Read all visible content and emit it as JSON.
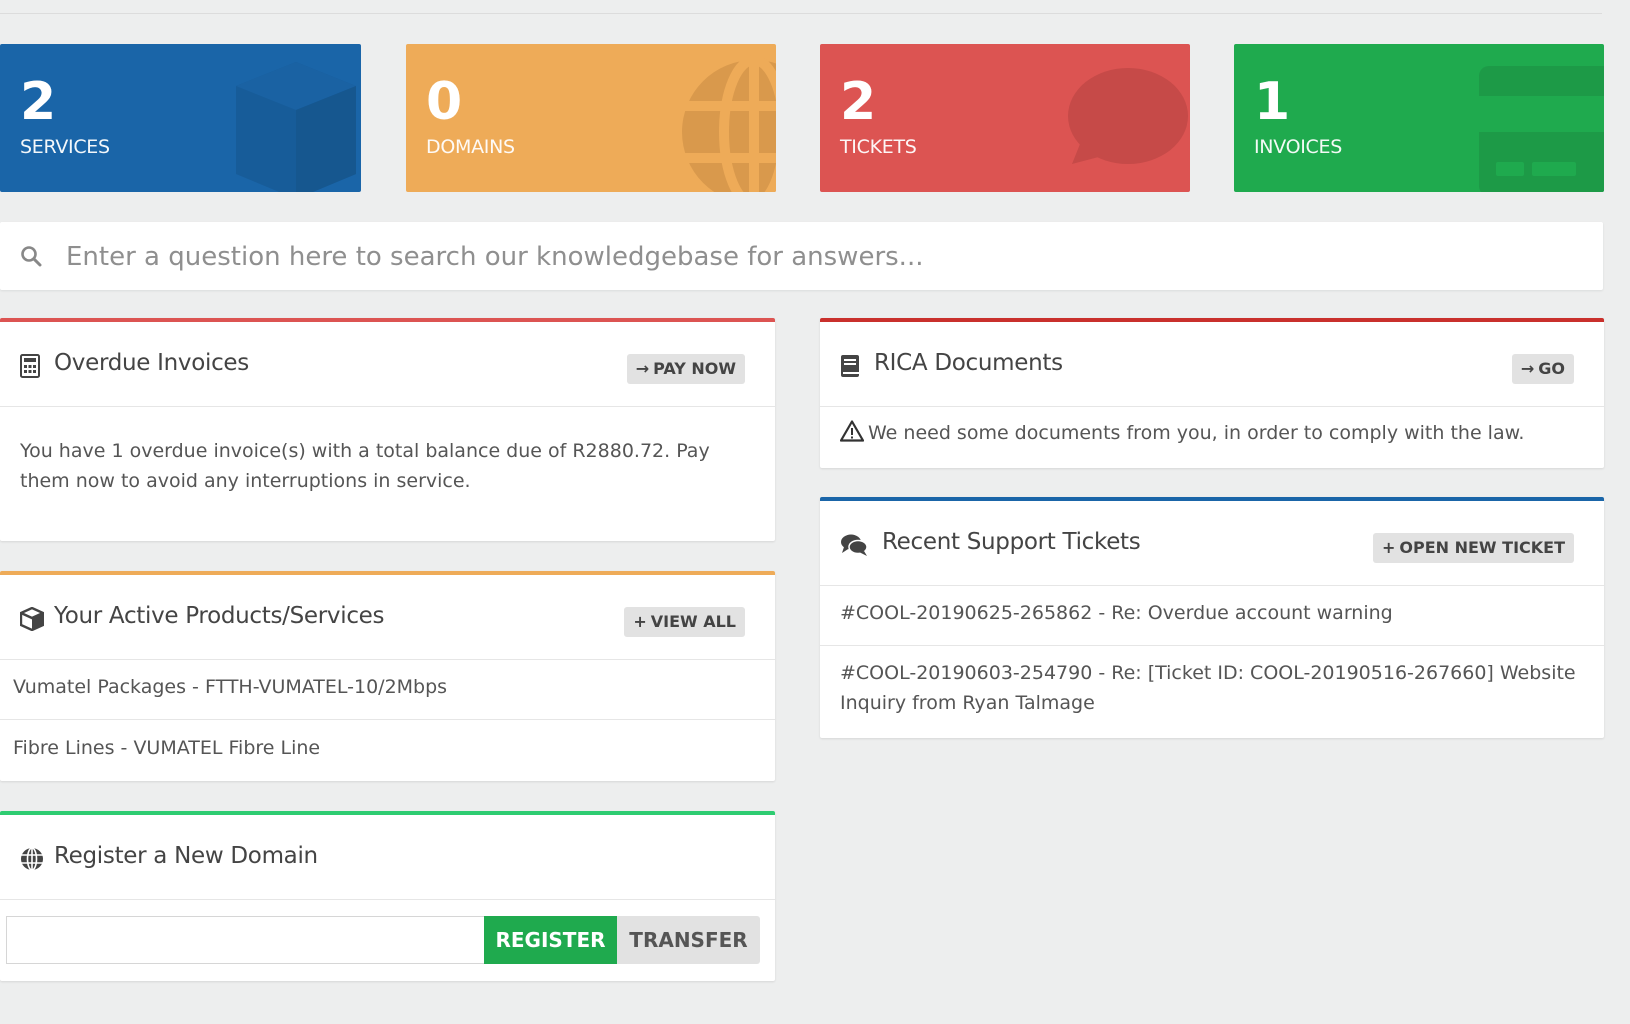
{
  "stats": [
    {
      "count": "2",
      "label": "SERVICES"
    },
    {
      "count": "0",
      "label": "DOMAINS"
    },
    {
      "count": "2",
      "label": "TICKETS"
    },
    {
      "count": "1",
      "label": "INVOICES"
    }
  ],
  "search": {
    "placeholder": "Enter a question here to search our knowledgebase for answers..."
  },
  "overdue": {
    "title": "Overdue Invoices",
    "button": "PAY NOW",
    "message_line1": "You have 1 overdue invoice(s) with a total balance due of R2880.72. Pay",
    "message_line2": "them now to avoid any interruptions in service."
  },
  "products": {
    "title": "Your Active Products/Services",
    "button": "VIEW ALL",
    "items": [
      "Vumatel Packages - FTTH-VUMATEL-10/2Mbps",
      "Fibre Lines - VUMATEL Fibre Line"
    ]
  },
  "domain": {
    "title": "Register a New Domain",
    "input_value": "",
    "register": "REGISTER",
    "transfer": "TRANSFER"
  },
  "rica": {
    "title": "RICA Documents",
    "button": "GO",
    "message": "We need some documents from you, in order to comply with the law."
  },
  "tickets": {
    "title": "Recent Support Tickets",
    "button": "OPEN NEW TICKET",
    "items": [
      {
        "line1": "#COOL-20190625-265862 - Re: Overdue account warning"
      },
      {
        "line1": "#COOL-20190603-254790 - Re: [Ticket ID: COOL-20190516-267660] Website",
        "line2": "Inquiry from Ryan Talmage"
      }
    ]
  },
  "colors": {
    "services": "#1a65a8",
    "domains": "#eeab58",
    "tickets": "#dc5452",
    "invoices": "#1faa4e",
    "overdue_accent": "#dc5452",
    "products_accent": "#eeab58",
    "domain_accent": "#2ecc71",
    "rica_accent": "#c9302c",
    "tickets_accent": "#1a65a8"
  }
}
